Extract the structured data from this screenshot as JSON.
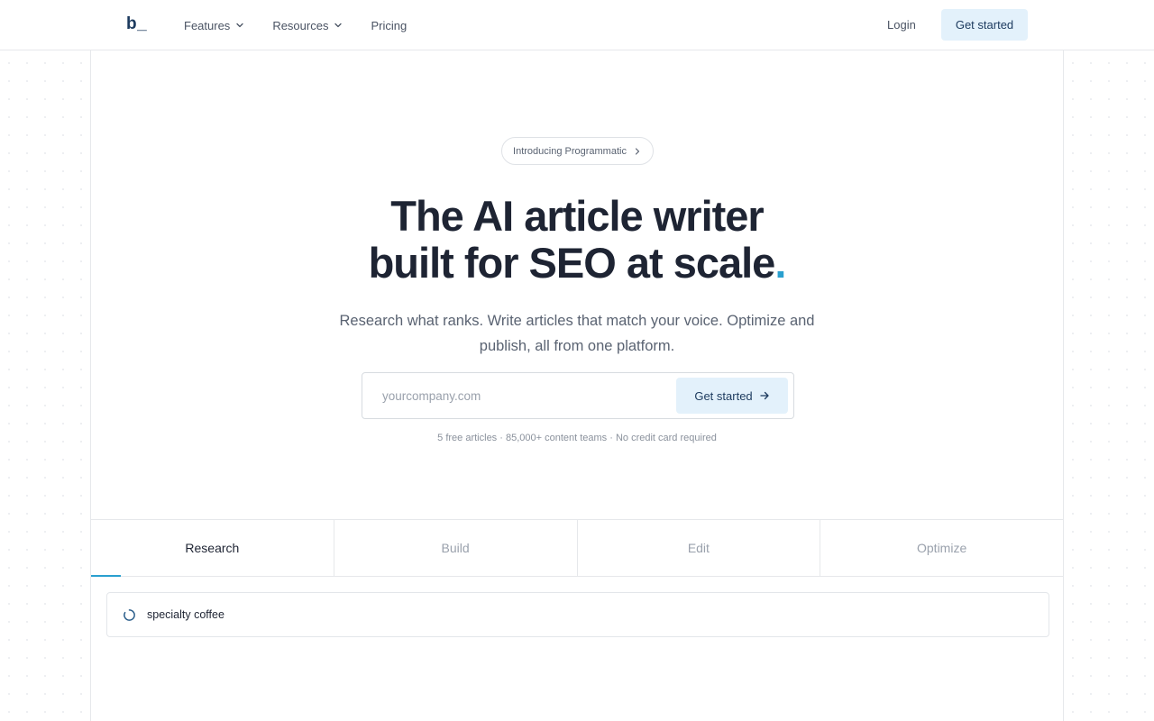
{
  "header": {
    "logo": "b_",
    "nav": [
      {
        "label": "Features",
        "has_dropdown": true
      },
      {
        "label": "Resources",
        "has_dropdown": true
      },
      {
        "label": "Pricing",
        "has_dropdown": false
      }
    ],
    "login": "Login",
    "cta": "Get started"
  },
  "hero": {
    "badge": "Introducing Programmatic",
    "headline_line1": "The AI article writer",
    "headline_line2": "built for SEO at scale",
    "headline_dot": ".",
    "subtext": "Research what ranks. Write articles that match your voice. Optimize and publish, all from one platform.",
    "input_placeholder": "yourcompany.com",
    "input_value": "",
    "cta": "Get started",
    "fine_print": "5 free articles · 85,000+ content teams · No credit card required"
  },
  "tabs": [
    {
      "label": "Research",
      "active": true
    },
    {
      "label": "Build",
      "active": false
    },
    {
      "label": "Edit",
      "active": false
    },
    {
      "label": "Optimize",
      "active": false
    }
  ],
  "research": {
    "query": "specialty coffee",
    "status_icon": "loading-spinner-icon"
  },
  "colors": {
    "accent": "#2aa0cf",
    "cta_bg": "#e3f1fb",
    "text_dark": "#1e2433",
    "text_muted": "#5a6372"
  }
}
